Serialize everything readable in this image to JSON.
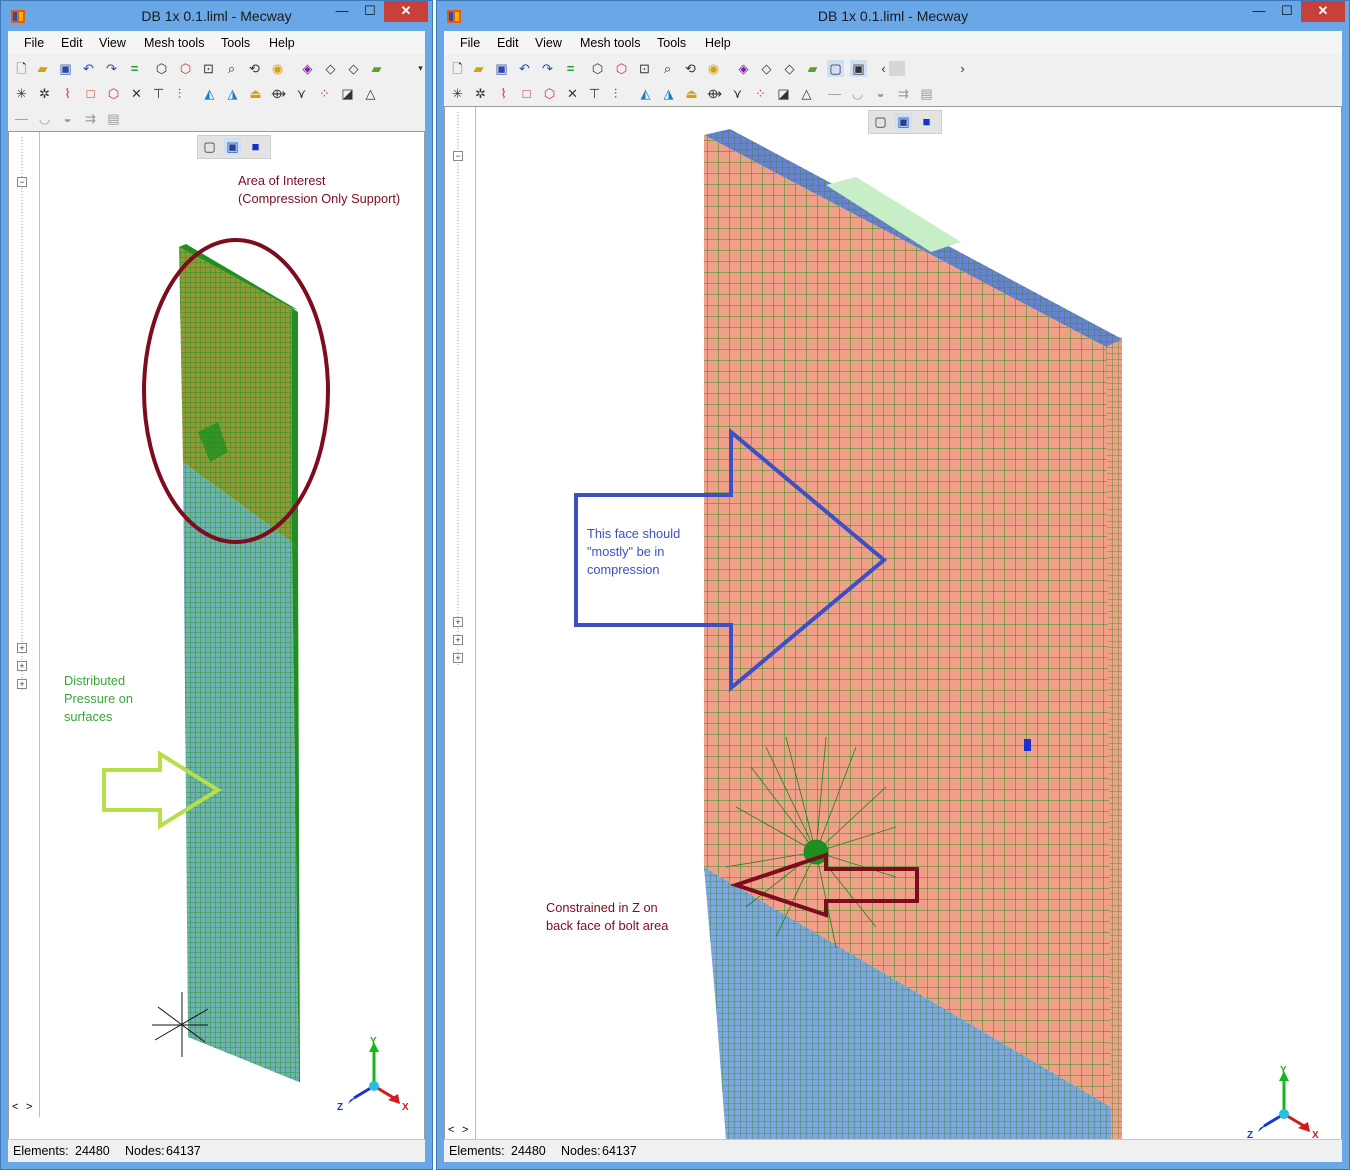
{
  "left_window": {
    "title": "DB 1x 0.1.liml - Mecway",
    "menu": [
      "File",
      "Edit",
      "View",
      "Mesh tools",
      "Tools",
      "Help"
    ],
    "annotations": {
      "area_of_interest": [
        "Area of Interest",
        "(Compression Only Support)"
      ],
      "distributed_pressure": [
        "Distributed",
        "Pressure on",
        "surfaces"
      ]
    },
    "status": {
      "elements_label": "Elements:",
      "elements_value": "24480",
      "nodes_label": "Nodes:",
      "nodes_value": "64137"
    }
  },
  "right_window": {
    "title": "DB 1x 0.1.liml - Mecway",
    "menu": [
      "File",
      "Edit",
      "View",
      "Mesh tools",
      "Tools",
      "Help"
    ],
    "annotations": {
      "compression_face": [
        "This face should",
        "\"mostly\" be in",
        "compression"
      ],
      "constrained": [
        "Constrained in Z on",
        "back face of bolt area"
      ]
    },
    "status": {
      "elements_label": "Elements:",
      "elements_value": "24480",
      "nodes_label": "Nodes:",
      "nodes_value": "64137"
    }
  },
  "window_controls": {
    "minimize": "—",
    "maximize": "☐",
    "close": "✕"
  },
  "axis_labels": {
    "x": "X",
    "y": "Y",
    "z": "Z"
  },
  "tree_expanders": {
    "expand": "+",
    "collapse": "−"
  },
  "scroll_arrows": {
    "left": "<",
    "right": ">"
  },
  "icons": [
    "new-file-icon",
    "open-folder-icon",
    "save-icon",
    "undo-icon",
    "redo-icon",
    "equals-icon",
    "cube-icon",
    "rotate-icon",
    "search-icon",
    "zoom-icon",
    "select-icon",
    "node-icon",
    "element-icon",
    "triangle-icon"
  ],
  "colors": {
    "title_bar": "#6aa7e6",
    "close_button": "#c7403a",
    "mesh_green": "#1f8f1f",
    "face_salmon": "#f0a088",
    "face_blue": "#7fa6e0",
    "annotation_red": "#7d0c1e",
    "annotation_blue": "#3c4fc4",
    "annotation_green": "#3aa63a",
    "arrow_lime": "#b5e04a"
  }
}
